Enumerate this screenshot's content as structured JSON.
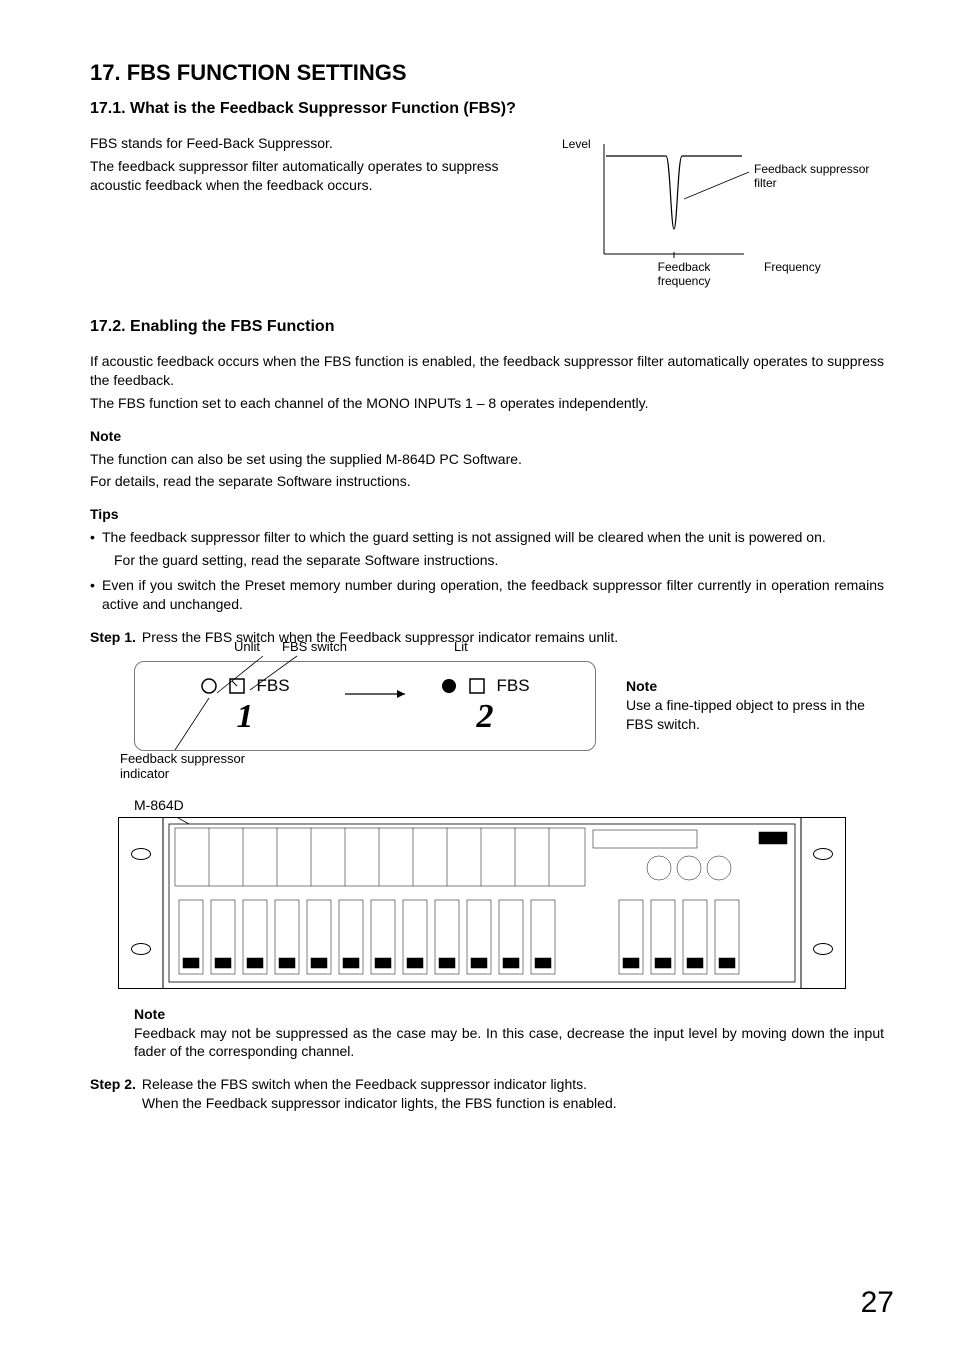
{
  "headings": {
    "title": "17. FBS FUNCTION SETTINGS",
    "s1": "17.1. What is the Feedback Suppressor Function (FBS)?",
    "s2": "17.2. Enabling the FBS Function"
  },
  "s1": {
    "p1": "FBS stands for Feed-Back Suppressor.",
    "p2": "The feedback suppressor filter automatically operates to suppress acoustic feedback when the feedback occurs."
  },
  "chart": {
    "ylabel": "Level",
    "xlabel": "Frequency",
    "annotation1": "Feedback suppressor filter",
    "annotation2": "Feedback frequency"
  },
  "chart_data": {
    "type": "line",
    "title": "",
    "xlabel": "Frequency",
    "ylabel": "Level",
    "series": [
      {
        "name": "Feedback suppressor filter",
        "description": "notch filter response — mostly flat with a narrow-band dip at the feedback frequency"
      }
    ],
    "annotations": [
      {
        "label": "Feedback frequency",
        "at": "notch center"
      },
      {
        "label": "Feedback suppressor filter",
        "at": "notch dip"
      }
    ]
  },
  "s2": {
    "p1": "If acoustic feedback occurs when the FBS function is enabled, the feedback suppressor filter automatically operates to suppress the feedback.",
    "p2": "The FBS function set to each channel of the MONO INPUTs 1 – 8 operates independently.",
    "note_h": "Note",
    "note1": "The function can also be set using the supplied M-864D PC Software.",
    "note2": "For details, read the separate Software instructions.",
    "tips_h": "Tips",
    "tip1": "The feedback suppressor filter to which the guard setting is not assigned will be cleared when the unit is powered on.",
    "tip1b": "For the guard setting, read the separate Software instructions.",
    "tip2": "Even if you switch the Preset memory number during operation, the feedback suppressor filter currently in operation remains active and unchanged."
  },
  "steps": {
    "s1_label": "Step 1.",
    "s1_text": "Press the FBS switch when the Feedback suppressor indicator remains unlit.",
    "s2_label": "Step 2.",
    "s2_text": "Release the FBS switch when the Feedback suppressor indicator lights.",
    "s2_text2": "When the Feedback suppressor indicator lights, the FBS function is enabled."
  },
  "switch_diagram": {
    "unlit": "Unlit",
    "lit": "Lit",
    "fbs": "FBS",
    "fbs_switch": "FBS switch",
    "indicator_label": "Feedback suppressor indicator",
    "n1": "1",
    "n2": "2",
    "note_h": "Note",
    "note": "Use a fine-tipped object to press in the FBS switch."
  },
  "panel": {
    "model": "M-864D"
  },
  "bottom_note": {
    "h": "Note",
    "text": "Feedback may not be suppressed as the case may be. In this case, decrease the input level by moving down the input fader of the corresponding channel."
  },
  "page_number": "27"
}
